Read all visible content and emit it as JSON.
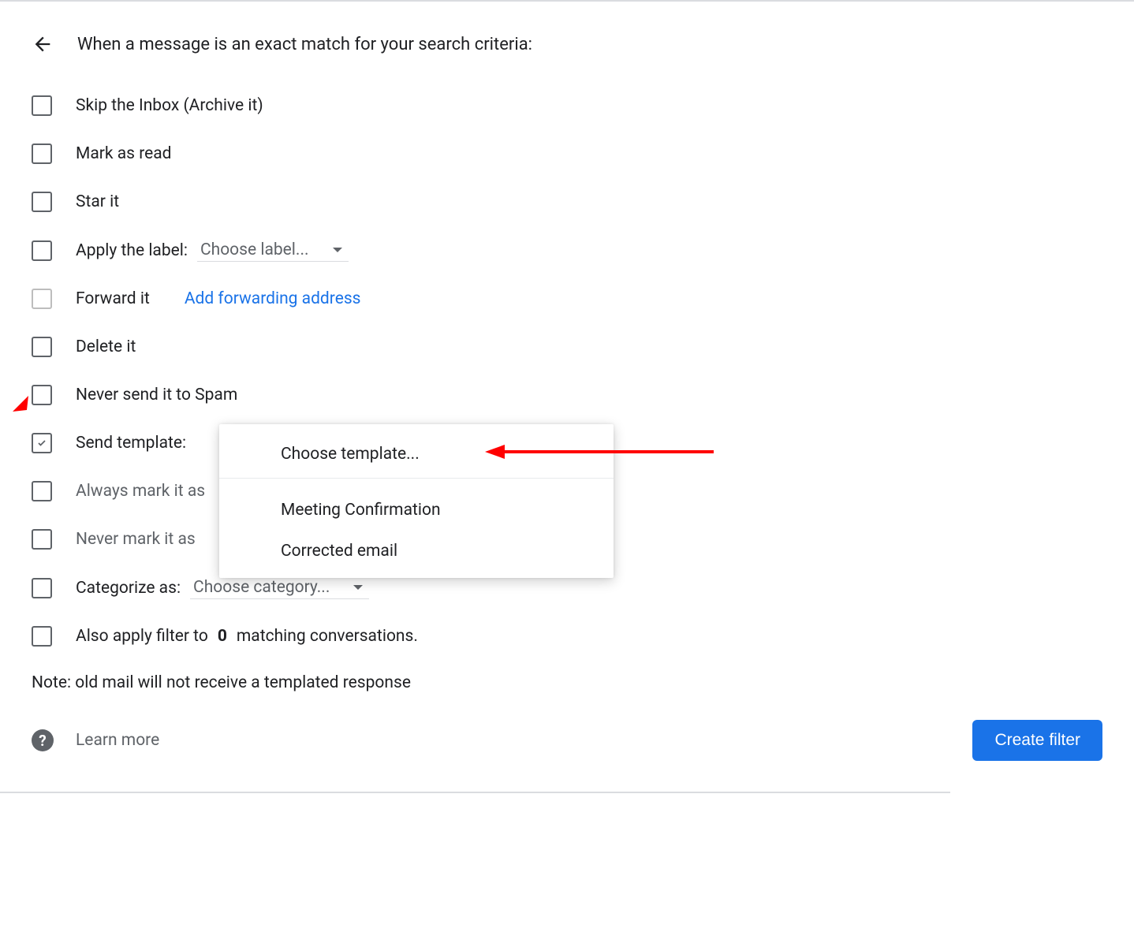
{
  "header": {
    "title": "When a message is an exact match for your search criteria:"
  },
  "options": {
    "skip_inbox": "Skip the Inbox (Archive it)",
    "mark_read": "Mark as read",
    "star_it": "Star it",
    "apply_label": "Apply the label:",
    "apply_label_select": "Choose label...",
    "forward_it": "Forward it",
    "add_forwarding": "Add forwarding address",
    "delete_it": "Delete it",
    "never_spam": "Never send it to Spam",
    "send_template": "Send template:",
    "always_important": "Always mark it as",
    "never_important": "Never mark it as",
    "categorize": "Categorize as:",
    "categorize_select": "Choose category...",
    "also_apply_prefix": "Also apply filter to",
    "also_apply_count": "0",
    "also_apply_suffix": "matching conversations."
  },
  "dropdown": {
    "header": "Choose template...",
    "items": [
      "Meeting Confirmation",
      "Corrected email"
    ]
  },
  "note": "Note: old mail will not receive a templated response",
  "footer": {
    "learn_more": "Learn more",
    "create_filter": "Create filter"
  }
}
